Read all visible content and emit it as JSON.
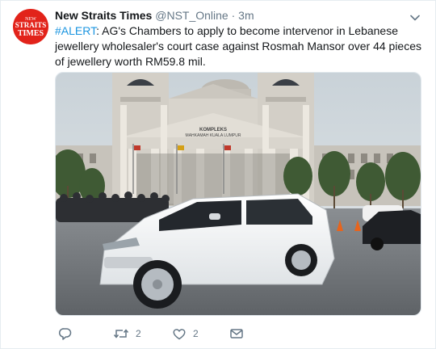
{
  "tweet": {
    "avatar": {
      "logo_lines": [
        "NEW",
        "STRAITS",
        "TIMES"
      ]
    },
    "display_name": "New Straits Times",
    "handle": "@NST_Online",
    "separator": "·",
    "time": "3m",
    "hashtag": "#ALERT",
    "text": ": AG's Chambers to apply to become intervenor in Lebanese jewellery wholesaler's court case against Rosmah Mansor over 44 pieces of jewellery worth RM59.8 mil.",
    "photo": {
      "building_sign": [
        "KOMPLEKS",
        "MAHKAMAH KUALA LUMPUR"
      ]
    },
    "actions": {
      "reply_count": "",
      "retweet_count": "2",
      "like_count": "2"
    }
  },
  "colors": {
    "link": "#1b95e0",
    "muted": "#657786",
    "brand_red": "#e2231a"
  },
  "icons": [
    "chevron-down-icon",
    "reply-icon",
    "retweet-icon",
    "like-icon",
    "message-icon"
  ]
}
